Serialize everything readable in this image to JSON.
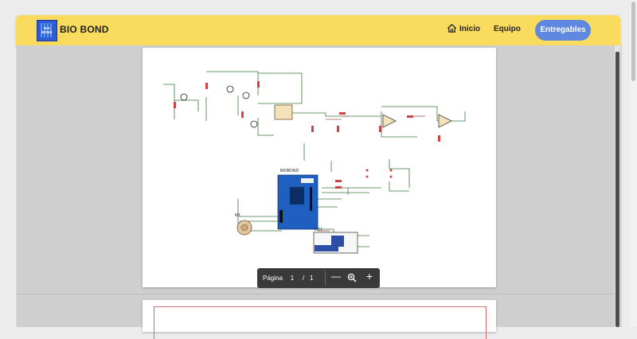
{
  "brand": {
    "logo_text": "BIO BOND",
    "name": "BIO BOND"
  },
  "nav": {
    "home_label": "Inicio",
    "team_label": "Equipo",
    "deliverables_label": "Entregables"
  },
  "pdf_toolbar": {
    "page_label": "Página",
    "current_page": "1",
    "separator": "/",
    "total_pages": "1",
    "zoom_out_glyph": "—",
    "zoom_in_glyph": "+"
  },
  "schematic_labels": {
    "arduino": "BIOBOND",
    "bluetooth": "HC1",
    "sensor": "M1"
  },
  "icons": [
    "home-icon",
    "zoom-icon",
    "zoom-out-icon",
    "zoom-in-icon"
  ],
  "colors": {
    "navbar": "#f9db5d",
    "cta": "#5f88e0",
    "arduino": "#1f5fbf",
    "wire": "#3b7a3b",
    "toolbar": "#3a3a3a"
  }
}
